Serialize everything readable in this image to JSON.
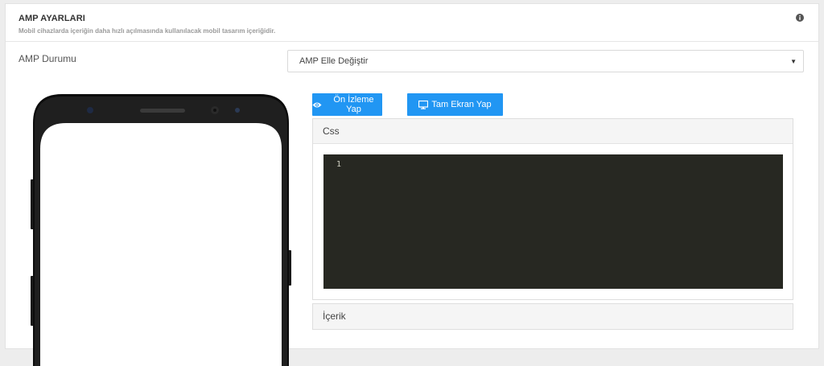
{
  "header": {
    "title": "AMP AYARLARI",
    "subtitle": "Mobil cihazlarda içeriğin daha hızlı açılmasında kullanılacak mobil tasarım içeriğidir."
  },
  "amp_status": {
    "label": "AMP Durumu",
    "selected": "AMP Elle Değiştir"
  },
  "toolbar": {
    "preview_label": "Ön İzleme Yap",
    "fullscreen_label": "Tam Ekran Yap"
  },
  "css_panel": {
    "title": "Css",
    "line_number": "1"
  },
  "content_panel": {
    "title": "İçerik"
  },
  "colors": {
    "accent": "#2196f3",
    "editor_bg": "#272822"
  },
  "icons": {
    "info": "info-icon",
    "select": "chevron-down-icon",
    "preview": "eye-icon",
    "fullscreen": "monitor-icon"
  }
}
